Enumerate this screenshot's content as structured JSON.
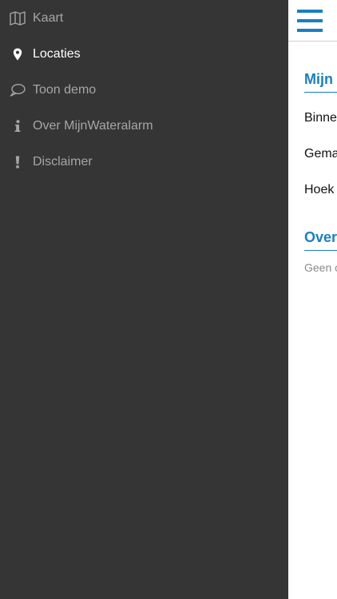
{
  "menu": {
    "items": [
      {
        "label": "Kaart",
        "icon": "map-icon",
        "active": false
      },
      {
        "label": "Locaties",
        "icon": "map-pin-icon",
        "active": true
      },
      {
        "label": "Toon demo",
        "icon": "speech-bubble-icon",
        "active": false
      },
      {
        "label": "Over MijnWateralarm",
        "icon": "info-icon",
        "active": false
      },
      {
        "label": "Disclaimer",
        "icon": "exclamation-icon",
        "active": false
      }
    ]
  },
  "main": {
    "menu_button_icon": "hamburger-icon",
    "sections": [
      {
        "title": "Mijn",
        "items": [
          "Binne",
          "Gema",
          "Hoek"
        ]
      },
      {
        "title": "Over",
        "empty_text": "Geen c"
      }
    ]
  },
  "colors": {
    "menu_background": "#353535",
    "menu_text": "#a6a6a6",
    "menu_text_active": "#ffffff",
    "accent": "#1a7fc1"
  }
}
